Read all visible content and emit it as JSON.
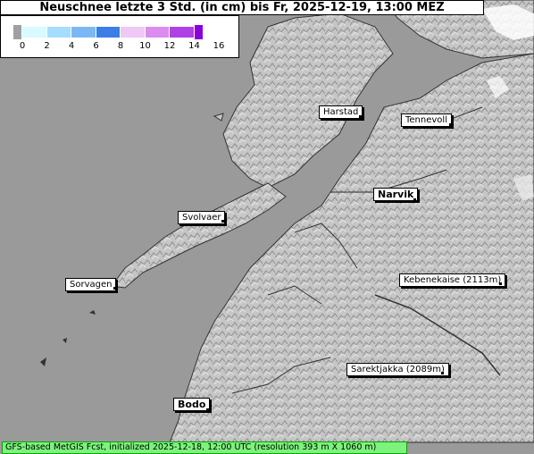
{
  "title": "Neuschnee letzte 3 Std. (in cm) bis Fr, 2025-12-19, 13:00 MEZ",
  "legend": {
    "ticks": [
      "0",
      "2",
      "4",
      "6",
      "8",
      "10",
      "12",
      "14",
      "16"
    ],
    "colors": [
      "#a0a0a0",
      "#d7fbff",
      "#a6dcff",
      "#7ab8f5",
      "#3a7ee6",
      "#f0c8f5",
      "#dc8cf0",
      "#b040e6",
      "#8a00dc"
    ]
  },
  "places": [
    {
      "name": "Harstad"
    },
    {
      "name": "Tennevoll"
    },
    {
      "name": "Narvik"
    },
    {
      "name": "Svolvaer"
    },
    {
      "name": "Sorvagen"
    },
    {
      "name": "Kebenekaise (2113m)"
    },
    {
      "name": "Sarektjakka (2089m)"
    },
    {
      "name": "Bodo"
    }
  ],
  "footer": "GFS-based MetGIS Fcst, initialized 2025-12-18, 12:00 UTC  (resolution 393 m X 1060 m)",
  "colors": {
    "sea": "#9a9a9a",
    "land": "#c8c8c8",
    "snow": "#ffffff",
    "footer": "#7df37d"
  }
}
